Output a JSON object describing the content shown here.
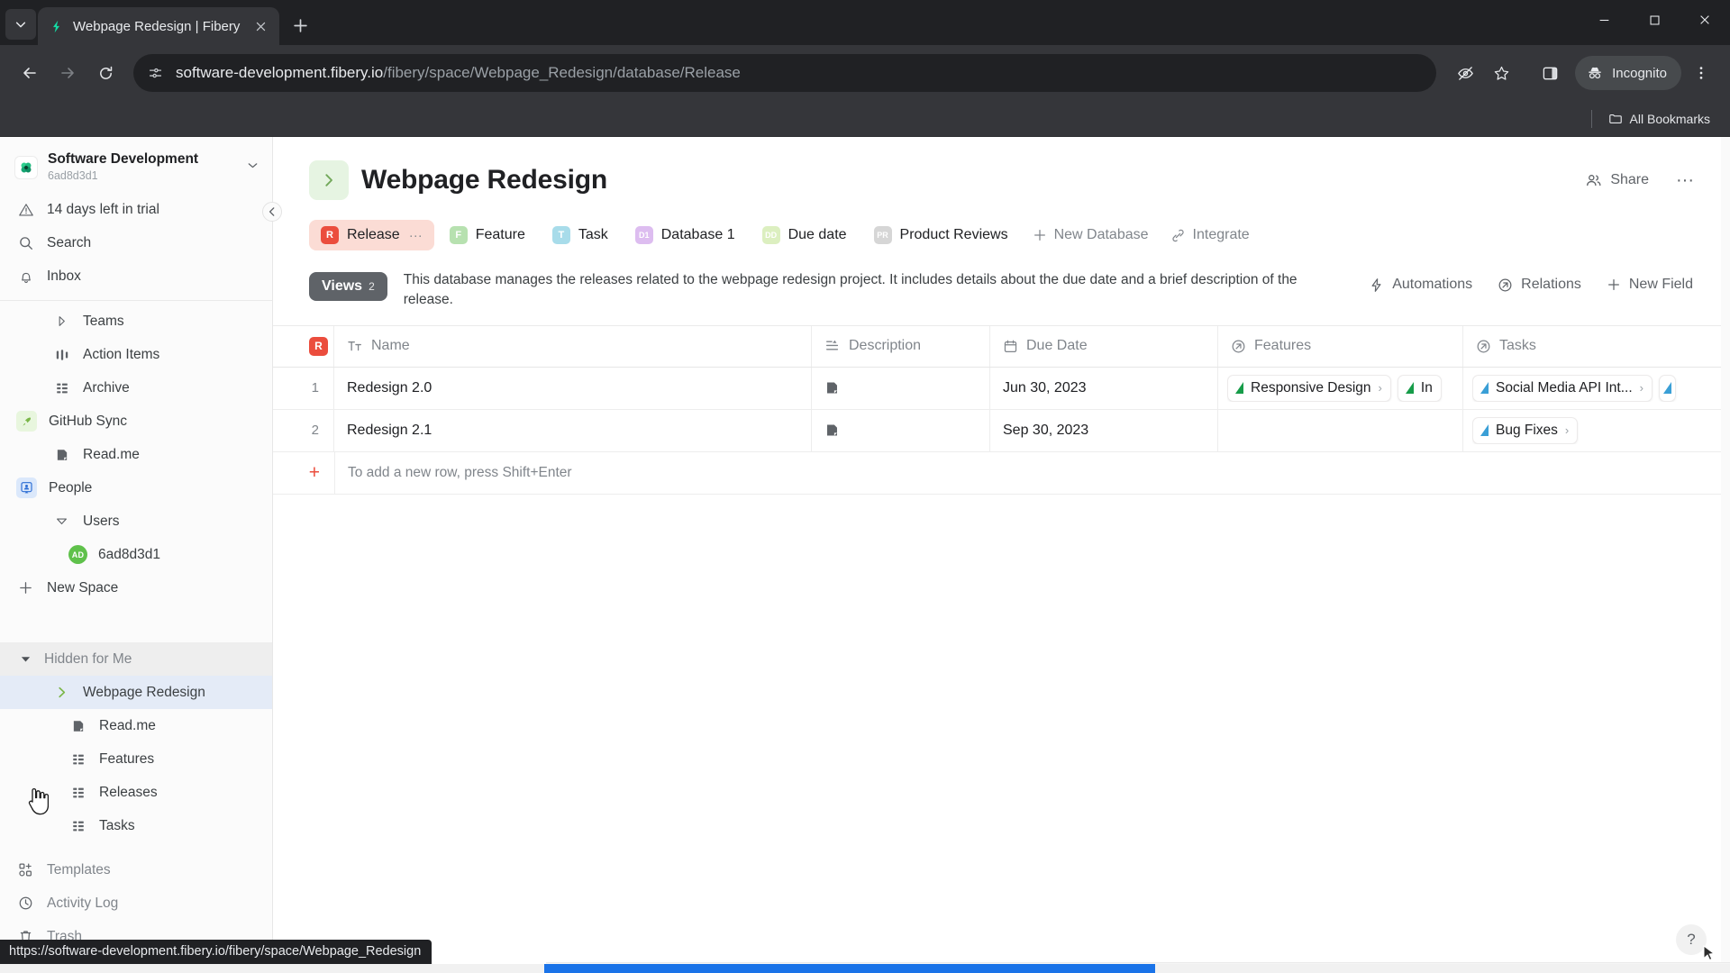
{
  "browser": {
    "tab": {
      "title": "Webpage Redesign | Fibery",
      "favicon": "fibery-logo-icon",
      "close_icon": "close-icon"
    },
    "new_tab_label": "+",
    "window_controls": {
      "minimize": "minimize-icon",
      "maximize": "maximize-icon",
      "close": "close-icon"
    },
    "nav": {
      "back": "back-arrow-icon",
      "forward": "forward-arrow-icon",
      "reload": "reload-icon"
    },
    "omnibox": {
      "site_info_icon": "site-settings-icon",
      "url_host": "software-development.fibery.io",
      "url_path": "/fibery/space/Webpage_Redesign/database/Release"
    },
    "actions": {
      "tracking_protection_icon": "eye-slash-icon",
      "bookmark_icon": "star-icon",
      "side_panel_icon": "side-panel-icon",
      "incognito_label": "Incognito",
      "incognito_icon": "incognito-hat-icon",
      "menu_icon": "three-dots-vertical-icon"
    },
    "bookmarks": {
      "all_bookmarks_label": "All Bookmarks",
      "folder_icon": "folder-icon"
    },
    "status_url": "https://software-development.fibery.io/fibery/space/Webpage_Redesign"
  },
  "sidebar": {
    "workspace": {
      "name": "Software Development",
      "id": "6ad8d3d1",
      "logo_icon": "fibery-clover-icon",
      "caret_icon": "chevron-down-icon"
    },
    "collapse_icon": "chevron-left-icon",
    "top_items": [
      {
        "label": "14 days left in trial",
        "icon": "warning-triangle-icon"
      },
      {
        "label": "Search",
        "icon": "search-icon"
      },
      {
        "label": "Inbox",
        "icon": "bell-icon"
      }
    ],
    "space_items": [
      {
        "label": "Teams",
        "icon": "chevron-right-outline-icon",
        "indent": "sub"
      },
      {
        "label": "Action Items",
        "icon": "columns-icon",
        "indent": "sub"
      },
      {
        "label": "Archive",
        "icon": "grid-icon",
        "indent": "sub"
      },
      {
        "label": "GitHub Sync",
        "icon": "rocket-icon",
        "indent": "root"
      },
      {
        "label": "Read.me",
        "icon": "document-icon",
        "indent": "sub"
      },
      {
        "label": "People",
        "icon": "people-badge-icon",
        "indent": "root"
      },
      {
        "label": "Users",
        "icon": "chevron-down-outline-icon",
        "indent": "sub"
      },
      {
        "label": "6ad8d3d1",
        "icon": "avatar",
        "avatar_initials": "AD",
        "indent": "sub2"
      },
      {
        "label": "New Space",
        "icon": "plus-icon",
        "indent": "root"
      }
    ],
    "hidden_section": {
      "label": "Hidden for Me",
      "toggle_icon": "caret-down-filled-icon",
      "items": [
        {
          "label": "Webpage Redesign",
          "icon": "chevron-right-green-icon",
          "selected": true,
          "indent": "sub"
        },
        {
          "label": "Read.me",
          "icon": "document-icon",
          "indent": "sub2"
        },
        {
          "label": "Features",
          "icon": "grid-icon",
          "indent": "sub2"
        },
        {
          "label": "Releases",
          "icon": "grid-icon",
          "indent": "sub2"
        },
        {
          "label": "Tasks",
          "icon": "grid-icon",
          "indent": "sub2"
        }
      ]
    },
    "bottom_items": [
      {
        "label": "Templates",
        "icon": "templates-icon"
      },
      {
        "label": "Activity Log",
        "icon": "clock-icon"
      },
      {
        "label": "Trash",
        "icon": "trash-icon"
      }
    ]
  },
  "main": {
    "title": "Webpage Redesign",
    "title_chevron_icon": "chevron-right-icon",
    "share_label": "Share",
    "share_icon": "people-icon",
    "more_label": "···",
    "db_tabs": [
      {
        "label": "Release",
        "badge": "R",
        "badge_color": "#eb4d3d",
        "active": true,
        "has_dots": true
      },
      {
        "label": "Feature",
        "badge": "F",
        "badge_color": "#b7e1b0",
        "active": false
      },
      {
        "label": "Task",
        "badge": "T",
        "badge_color": "#a8dcea",
        "active": false
      },
      {
        "label": "Database 1",
        "badge": "D1",
        "badge_color": "#ddbdf0",
        "active": false
      },
      {
        "label": "Due date",
        "badge": "DD",
        "badge_color": "#dcefc0",
        "active": false
      },
      {
        "label": "Product Reviews",
        "badge": "PR",
        "badge_color": "#d6d6d6",
        "active": false
      }
    ],
    "db_actions": [
      {
        "label": "New Database",
        "icon": "plus-icon"
      },
      {
        "label": "Integrate",
        "icon": "plug-icon"
      }
    ],
    "views": {
      "label": "Views",
      "count": "2"
    },
    "description": "This database manages the releases related to the webpage redesign project. It includes details about the due date and a brief description of the release.",
    "tools": [
      {
        "label": "Automations",
        "icon": "lightning-icon"
      },
      {
        "label": "Relations",
        "icon": "arrow-circle-icon"
      },
      {
        "label": "New Field",
        "icon": "plus-icon"
      }
    ]
  },
  "table": {
    "row_badge": "R",
    "columns": [
      {
        "label": "Name",
        "icon": "text-format-icon"
      },
      {
        "label": "Description",
        "icon": "paragraph-icon"
      },
      {
        "label": "Due Date",
        "icon": "calendar-icon"
      },
      {
        "label": "Features",
        "icon": "arrow-circle-icon"
      },
      {
        "label": "Tasks",
        "icon": "arrow-circle-icon"
      }
    ],
    "rows": [
      {
        "num": "1",
        "name": "Redesign 2.0",
        "description_icon": "document-icon",
        "due_date": "Jun 30, 2023",
        "features": [
          {
            "label": "Responsive Design",
            "color": "green"
          },
          {
            "label": "In",
            "color": "green",
            "clipped": true
          }
        ],
        "tasks": [
          {
            "label": "Social Media API Int...",
            "color": "blue"
          },
          {
            "label": "",
            "color": "blue",
            "clipped": true
          }
        ]
      },
      {
        "num": "2",
        "name": "Redesign 2.1",
        "description_icon": "document-icon",
        "due_date": "Sep 30, 2023",
        "features": [],
        "tasks": [
          {
            "label": "Bug Fixes",
            "color": "blue"
          }
        ]
      }
    ],
    "add_row": {
      "plus": "+",
      "hint": "To add a new row, press Shift+Enter"
    }
  },
  "help": {
    "label": "?"
  }
}
